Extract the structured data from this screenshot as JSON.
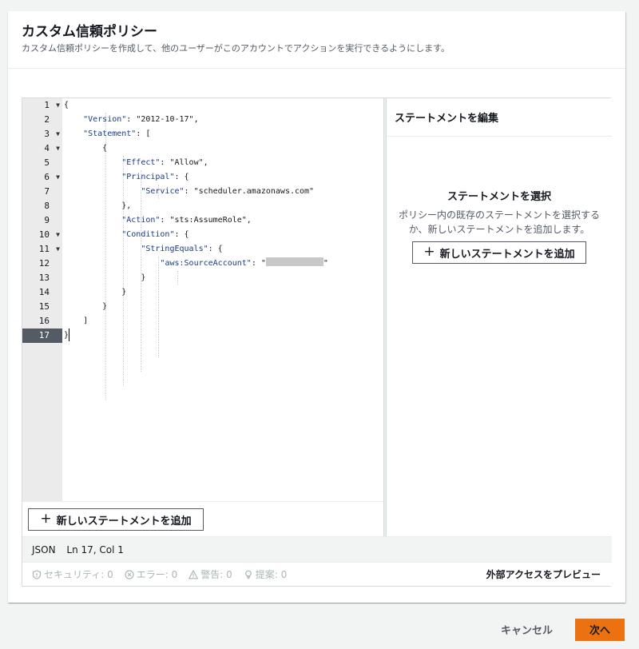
{
  "page": {
    "title": "カスタム信頼ポリシー",
    "description": "カスタム信頼ポリシーを作成して、他のユーザーがこのアカウントでアクションを実行できるようにします。"
  },
  "editor": {
    "lines": [
      {
        "n": "1",
        "fold": true
      },
      {
        "n": "2",
        "fold": false
      },
      {
        "n": "3",
        "fold": true
      },
      {
        "n": "4",
        "fold": true
      },
      {
        "n": "5",
        "fold": false
      },
      {
        "n": "6",
        "fold": true
      },
      {
        "n": "7",
        "fold": false
      },
      {
        "n": "8",
        "fold": false
      },
      {
        "n": "9",
        "fold": false
      },
      {
        "n": "10",
        "fold": true
      },
      {
        "n": "11",
        "fold": true
      },
      {
        "n": "12",
        "fold": false
      },
      {
        "n": "13",
        "fold": false
      },
      {
        "n": "14",
        "fold": false
      },
      {
        "n": "15",
        "fold": false
      },
      {
        "n": "16",
        "fold": false
      },
      {
        "n": "17",
        "fold": false
      }
    ],
    "active_line": "17",
    "code": {
      "l1": "{",
      "l2_key": "\"Version\"",
      "l2_val": "\"2012-10-17\"",
      "l3_key": "\"Statement\"",
      "l3_rest": ": [",
      "l4": "{",
      "l5_key": "\"Effect\"",
      "l5_val": "\"Allow\"",
      "l6_key": "\"Principal\"",
      "l6_rest": ": {",
      "l7_key": "\"Service\"",
      "l7_val": "\"scheduler.amazonaws.com\"",
      "l8": "},",
      "l9_key": "\"Action\"",
      "l9_val": "\"sts:AssumeRole\"",
      "l10_key": "\"Condition\"",
      "l10_rest": ": {",
      "l11_key": "\"StringEquals\"",
      "l11_rest": ": {",
      "l12_key": "\"aws:SourceAccount\"",
      "l12_open": "\"",
      "l12_close": "\"",
      "l13": "}",
      "l14": "}",
      "l15": "}",
      "l16": "]",
      "l17": "}"
    },
    "add_statement_label": "新しいステートメントを追加"
  },
  "side_panel": {
    "header": "ステートメントを編集",
    "title": "ステートメントを選択",
    "description": "ポリシー内の既存のステートメントを選択するか、新しいステートメントを追加します。",
    "add_statement_label": "新しいステートメントを追加"
  },
  "status": {
    "mode": "JSON",
    "position": "Ln 17, Col 1"
  },
  "validation": {
    "security": "セキュリティ: 0",
    "errors": "エラー: 0",
    "warnings": "警告: 0",
    "suggestions": "提案: 0",
    "preview_external_access": "外部アクセスをプレビュー"
  },
  "actions": {
    "cancel": "キャンセル",
    "next": "次へ"
  },
  "colors": {
    "primary_button": "#ec7211",
    "gutter": "#ebebeb",
    "active_line_number": "#545b64"
  }
}
